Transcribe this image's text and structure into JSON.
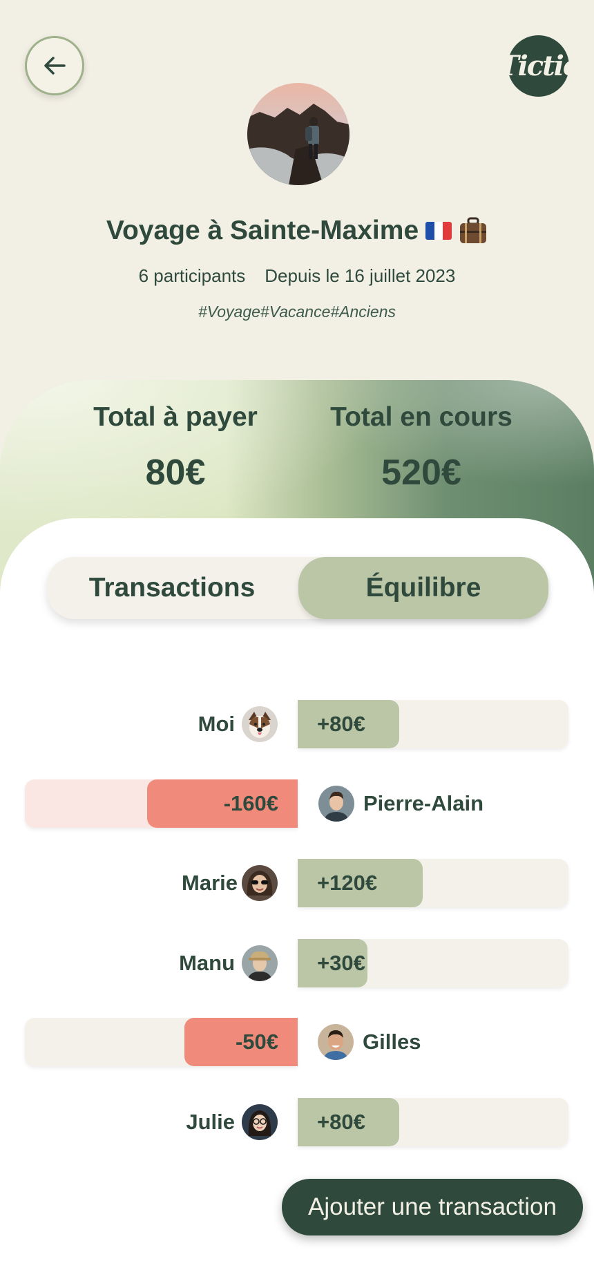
{
  "header": {
    "back_icon": "arrow-left-icon",
    "logo_text": "Tictic"
  },
  "group": {
    "title": "Voyage à Sainte-Maxime",
    "title_emojis": [
      "🇫🇷",
      "💼"
    ],
    "participants": "6 participants",
    "since": "Depuis le 16 juillet 2023",
    "tags": "#Voyage#Vacance#Anciens"
  },
  "totals": {
    "to_pay_label": "Total à payer",
    "to_pay_value": "80€",
    "ongoing_label": "Total en cours",
    "ongoing_value": "520€"
  },
  "tabs": [
    {
      "label": "Transactions",
      "active": false
    },
    {
      "label": "Équilibre",
      "active": true
    }
  ],
  "balances": [
    {
      "name": "Moi",
      "amount": "+80€",
      "value": 80
    },
    {
      "name": "Pierre-Alain",
      "amount": "-160€",
      "value": -160
    },
    {
      "name": "Marie",
      "amount": "+120€",
      "value": 120
    },
    {
      "name": "Manu",
      "amount": "+30€",
      "value": 30
    },
    {
      "name": "Gilles",
      "amount": "-50€",
      "value": -50
    },
    {
      "name": "Julie",
      "amount": "+80€",
      "value": 80
    }
  ],
  "cta_label": "Ajouter une transaction",
  "colors": {
    "primary": "#2f4a3d",
    "background": "#f2efe4",
    "positive": "#bbc6a7",
    "negative": "#f08a7b"
  }
}
